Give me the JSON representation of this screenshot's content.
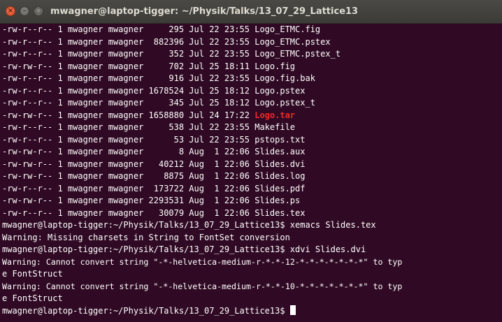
{
  "window": {
    "title": "mwagner@laptop-tigger: ~/Physik/Talks/13_07_29_Lattice13",
    "close_glyph": "×",
    "minimize_glyph": "–",
    "maximize_glyph": "□"
  },
  "listing": [
    {
      "perms": "-rw-r--r--",
      "links": "1",
      "owner": "mwagner",
      "group": "mwagner",
      "size": "295",
      "date": "Jul 22 23:55",
      "name": "Logo_ETMC.fig",
      "highlight": false
    },
    {
      "perms": "-rw-r--r--",
      "links": "1",
      "owner": "mwagner",
      "group": "mwagner",
      "size": "882396",
      "date": "Jul 22 23:55",
      "name": "Logo_ETMC.pstex",
      "highlight": false
    },
    {
      "perms": "-rw-r--r--",
      "links": "1",
      "owner": "mwagner",
      "group": "mwagner",
      "size": "352",
      "date": "Jul 22 23:55",
      "name": "Logo_ETMC.pstex_t",
      "highlight": false
    },
    {
      "perms": "-rw-rw-r--",
      "links": "1",
      "owner": "mwagner",
      "group": "mwagner",
      "size": "702",
      "date": "Jul 25 18:11",
      "name": "Logo.fig",
      "highlight": false
    },
    {
      "perms": "-rw-r--r--",
      "links": "1",
      "owner": "mwagner",
      "group": "mwagner",
      "size": "916",
      "date": "Jul 22 23:55",
      "name": "Logo.fig.bak",
      "highlight": false
    },
    {
      "perms": "-rw-r--r--",
      "links": "1",
      "owner": "mwagner",
      "group": "mwagner",
      "size": "1678524",
      "date": "Jul 25 18:12",
      "name": "Logo.pstex",
      "highlight": false
    },
    {
      "perms": "-rw-r--r--",
      "links": "1",
      "owner": "mwagner",
      "group": "mwagner",
      "size": "345",
      "date": "Jul 25 18:12",
      "name": "Logo.pstex_t",
      "highlight": false
    },
    {
      "perms": "-rw-rw-r--",
      "links": "1",
      "owner": "mwagner",
      "group": "mwagner",
      "size": "1658880",
      "date": "Jul 24 17:22",
      "name": "Logo.tar",
      "highlight": true
    },
    {
      "perms": "-rw-r--r--",
      "links": "1",
      "owner": "mwagner",
      "group": "mwagner",
      "size": "538",
      "date": "Jul 22 23:55",
      "name": "Makefile",
      "highlight": false
    },
    {
      "perms": "-rw-r--r--",
      "links": "1",
      "owner": "mwagner",
      "group": "mwagner",
      "size": "53",
      "date": "Jul 22 23:55",
      "name": "pstops.txt",
      "highlight": false
    },
    {
      "perms": "-rw-rw-r--",
      "links": "1",
      "owner": "mwagner",
      "group": "mwagner",
      "size": "8",
      "date": "Aug  1 22:06",
      "name": "Slides.aux",
      "highlight": false
    },
    {
      "perms": "-rw-rw-r--",
      "links": "1",
      "owner": "mwagner",
      "group": "mwagner",
      "size": "40212",
      "date": "Aug  1 22:06",
      "name": "Slides.dvi",
      "highlight": false
    },
    {
      "perms": "-rw-rw-r--",
      "links": "1",
      "owner": "mwagner",
      "group": "mwagner",
      "size": "8875",
      "date": "Aug  1 22:06",
      "name": "Slides.log",
      "highlight": false
    },
    {
      "perms": "-rw-r--r--",
      "links": "1",
      "owner": "mwagner",
      "group": "mwagner",
      "size": "173722",
      "date": "Aug  1 22:06",
      "name": "Slides.pdf",
      "highlight": false
    },
    {
      "perms": "-rw-rw-r--",
      "links": "1",
      "owner": "mwagner",
      "group": "mwagner",
      "size": "2293531",
      "date": "Aug  1 22:06",
      "name": "Slides.ps",
      "highlight": false
    },
    {
      "perms": "-rw-r--r--",
      "links": "1",
      "owner": "mwagner",
      "group": "mwagner",
      "size": "30079",
      "date": "Aug  1 22:06",
      "name": "Slides.tex",
      "highlight": false
    }
  ],
  "session": [
    {
      "kind": "command",
      "text": "mwagner@laptop-tigger:~/Physik/Talks/13_07_29_Lattice13$ xemacs Slides.tex"
    },
    {
      "kind": "output",
      "text": "Warning: Missing charsets in String to FontSet conversion"
    },
    {
      "kind": "command",
      "text": "mwagner@laptop-tigger:~/Physik/Talks/13_07_29_Lattice13$ xdvi Slides.dvi"
    },
    {
      "kind": "output",
      "text": "Warning: Cannot convert string \"-*-helvetica-medium-r-*-*-12-*-*-*-*-*-*-*\" to typ"
    },
    {
      "kind": "output",
      "text": "e FontStruct"
    },
    {
      "kind": "output",
      "text": "Warning: Cannot convert string \"-*-helvetica-medium-r-*-*-10-*-*-*-*-*-*-*\" to typ"
    },
    {
      "kind": "output",
      "text": "e FontStruct"
    }
  ],
  "prompt": "mwagner@laptop-tigger:~/Physik/Talks/13_07_29_Lattice13$ "
}
